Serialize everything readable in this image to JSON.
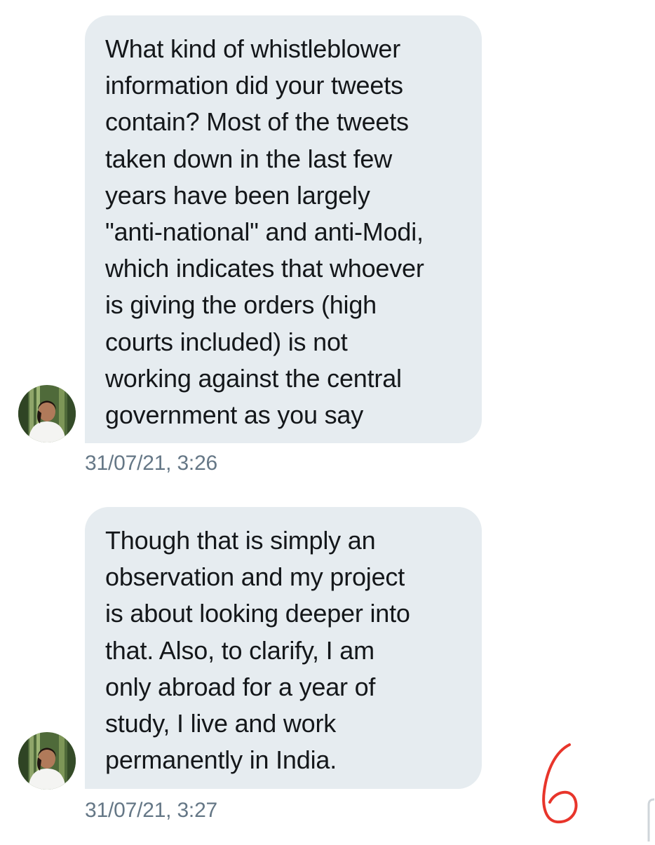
{
  "conversation": {
    "messages": [
      {
        "text": "What kind of whistleblower\ninformation did your tweets\ncontain? Most of the tweets\ntaken down in the last few\nyears have been largely\n\"anti-national\" and anti-Modi,\nwhich indicates that whoever\nis giving the orders (high\ncourts included) is not\nworking against the central\ngovernment as you say",
        "timestamp": "31/07/21, 3:26",
        "avatar": "user-profile-photo"
      },
      {
        "text": "Though that is simply an\nobservation and my project\nis about looking deeper into\nthat. Also, to clarify, I am\nonly abroad for a year of\nstudy, I live and work\npermanently in India.",
        "timestamp": "31/07/21, 3:27",
        "avatar": "user-profile-photo"
      }
    ]
  },
  "annotation": {
    "number": "6",
    "color": "#e8352b"
  },
  "colors": {
    "bubble": "#e6ecf0",
    "text": "#14171a",
    "timestamp": "#657786"
  }
}
